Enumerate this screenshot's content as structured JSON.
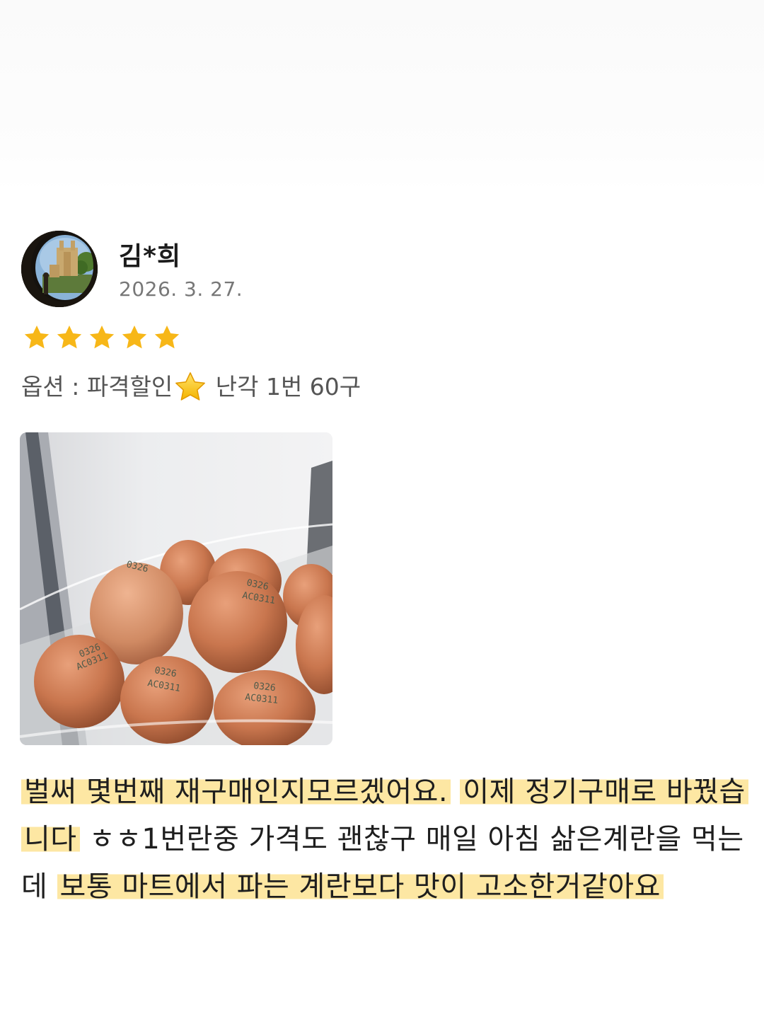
{
  "review": {
    "author_name": "김*희",
    "date": "2026. 3. 27.",
    "rating": 5,
    "rating_max": 5,
    "option_prefix": "옵션 : 파격할인",
    "option_suffix": " 난각 1번 60구",
    "option_emoji": "star-emoji-icon",
    "photo": "brown-eggs-in-fridge-photo",
    "egg_stamps": [
      "0326",
      "AC0311"
    ],
    "body": {
      "seg1": "벌써 몇번째 재구매인지모르겠어요.",
      "seg2": " ",
      "seg3": "이제 정기구매로 바꿨습니다",
      "seg4": " ㅎㅎ1번란중 가격도 괜찮구 매일 아침 삶은계란을 먹는데 ",
      "seg5": "보통 마트에서 파는 계란보다 맛이 고소한거같아요"
    }
  },
  "colors": {
    "star": "#f7b718",
    "highlight": "#fde7a3",
    "date_text": "#777777"
  }
}
